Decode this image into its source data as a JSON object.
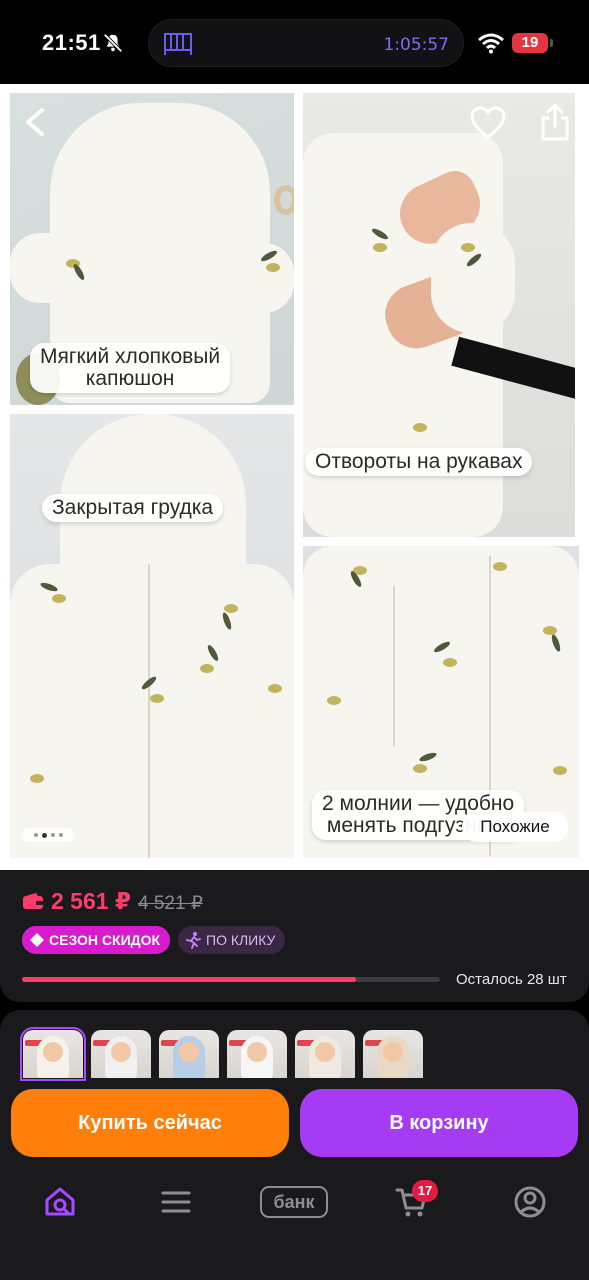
{
  "status_bar": {
    "time": "21:51",
    "timer": "1:05:57",
    "battery": "19"
  },
  "gallery": {
    "captions": {
      "hood": "Мягкий хлопковый\nкапюшон",
      "cuffs": "Отвороты на рукавах",
      "chest": "Закрытая грудка",
      "zippers": "2 молнии — удобно\nменять подгузники"
    },
    "similar_label": "Похожие",
    "page_dots": 4,
    "active_dot": 1
  },
  "price": {
    "current": "2 561 ₽",
    "old": "4 521 ₽",
    "tags": {
      "sale": "СЕЗОН СКИДОК",
      "click": "ПО КЛИКУ"
    },
    "stock_progress": 0.8,
    "remaining": "Осталось 28 шт"
  },
  "variants": {
    "count": 6,
    "selected_index": 0
  },
  "actions": {
    "buy_now": "Купить сейчас",
    "add_to_cart": "В корзину"
  },
  "bottom_nav": {
    "bank": "банк",
    "cart_count": "17"
  },
  "colors": {
    "accent_pink": "#ff3d6a",
    "buy_orange": "#ff7f0a",
    "cart_purple": "#a53cf3",
    "sale_magenta": "#d91bd0"
  }
}
